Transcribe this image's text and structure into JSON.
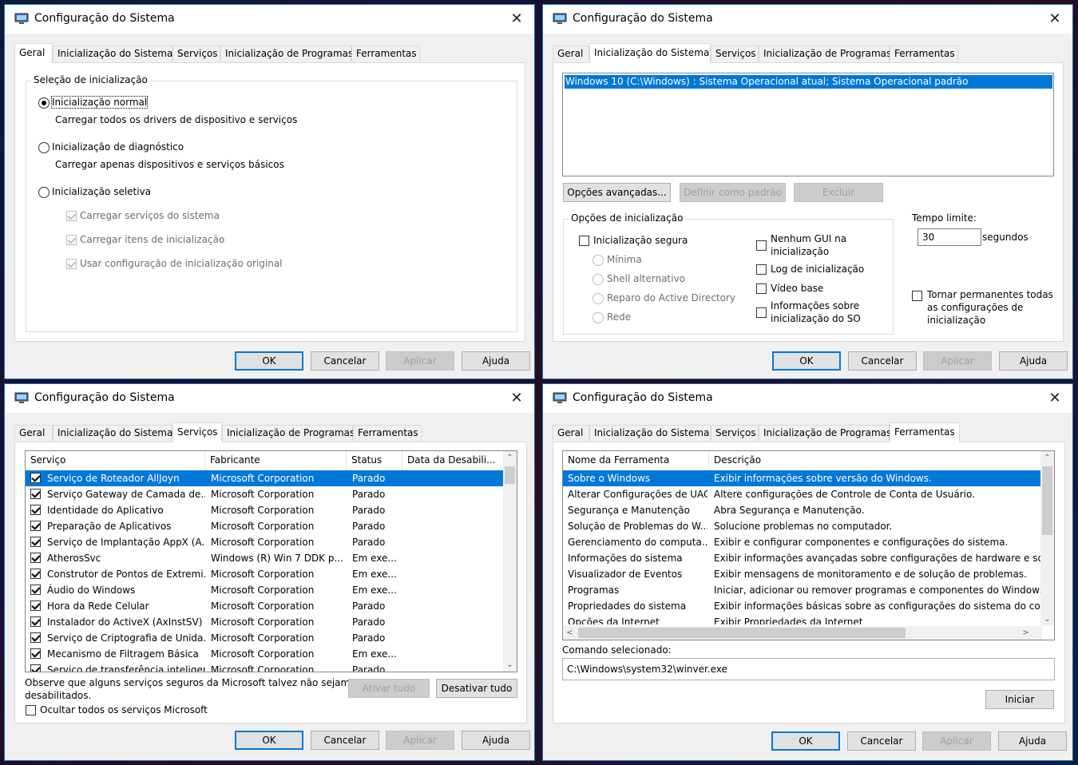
{
  "title": "Configuração do Sistema",
  "tabs": [
    "Geral",
    "Inicialização do Sistema",
    "Serviços",
    "Inicialização de Programas",
    "Ferramentas"
  ],
  "buttons": {
    "ok": "OK",
    "cancel": "Cancelar",
    "apply": "Aplicar",
    "help": "Ajuda"
  },
  "geral": {
    "group_title": "Seleção de inicialização",
    "normal": "Inicialização normal",
    "normal_desc": "Carregar todos os drivers de dispositivo e serviços",
    "diag": "Inicialização de diagnóstico",
    "diag_desc": "Carregar apenas dispositivos e serviços básicos",
    "selective": "Inicialização seletiva",
    "opt1": "Carregar serviços do sistema",
    "opt2": "Carregar itens de inicialização",
    "opt3": "Usar configuração de inicialização original"
  },
  "boot": {
    "os_entry": "Windows 10 (C:\\Windows) : Sistema Operacional atual; Sistema Operacional padrão",
    "advanced": "Opções avançadas...",
    "set_default": "Definir como padrão",
    "delete": "Excluir",
    "options_title": "Opções de inicialização",
    "safe": "Inicialização segura",
    "minimal": "Mínima",
    "shell": "Shell alternativo",
    "ad": "Reparo do Active Directory",
    "net": "Rede",
    "nogui1": "Nenhum GUI na",
    "nogui2": "inicialização",
    "log": "Log de inicialização",
    "video": "Vídeo base",
    "info1": "Informações sobre",
    "info2": "inicialização do SO",
    "timeout_label": "Tempo limite:",
    "timeout_value": "30",
    "seconds": "segundos",
    "perm1": "Tornar permanentes todas",
    "perm2": "as configurações de",
    "perm3": "inicialização"
  },
  "services": {
    "headers": [
      "Serviço",
      "Fabricante",
      "Status",
      "Data da Desabili..."
    ],
    "rows": [
      [
        "Serviço de Roteador AllJoyn",
        "Microsoft Corporation",
        "Parado"
      ],
      [
        "Serviço Gateway de Camada de...",
        "Microsoft Corporation",
        "Parado"
      ],
      [
        "Identidade do Aplicativo",
        "Microsoft Corporation",
        "Parado"
      ],
      [
        "Preparação de Aplicativos",
        "Microsoft Corporation",
        "Parado"
      ],
      [
        "Serviço de Implantação AppX (A...",
        "Microsoft Corporation",
        "Parado"
      ],
      [
        "AtherosSvc",
        "Windows (R) Win 7 DDK p...",
        "Em exe..."
      ],
      [
        "Construtor de Pontos de Extremi...",
        "Microsoft Corporation",
        "Em exe..."
      ],
      [
        "Áudio do Windows",
        "Microsoft Corporation",
        "Em exe..."
      ],
      [
        "Hora da Rede Celular",
        "Microsoft Corporation",
        "Parado"
      ],
      [
        "Instalador do ActiveX (AxInstSV)",
        "Microsoft Corporation",
        "Parado"
      ],
      [
        "Serviço de Criptografia de Unida...",
        "Microsoft Corporation",
        "Parado"
      ],
      [
        "Mecanismo de Filtragem Básica",
        "Microsoft Corporation",
        "Em exe..."
      ],
      [
        "Serviço de transferência inteligente...",
        "Microsoft Corporation",
        "Parado"
      ]
    ],
    "note1": "Observe que alguns serviços seguros da Microsoft talvez não sejam",
    "note2": "desabilitados.",
    "enable_all": "Ativar tudo",
    "disable_all": "Desativar tudo",
    "hide_ms": "Ocultar todos os serviços Microsoft"
  },
  "tools": {
    "headers": [
      "Nome da Ferramenta",
      "Descrição"
    ],
    "rows": [
      [
        "Sobre o Windows",
        "Exibir informações sobre versão do Windows."
      ],
      [
        "Alterar Configurações de UAC",
        "Altere configurações de Controle de Conta de Usuário."
      ],
      [
        "Segurança e Manutenção",
        "Abra Segurança e Manutenção."
      ],
      [
        "Solução de Problemas do W...",
        "Solucione problemas no computador."
      ],
      [
        "Gerenciamento do computa...",
        "Exibir e configurar componentes e configurações do sistema."
      ],
      [
        "Informações do sistema",
        "Exibir informações avançadas sobre configurações de hardware e soft"
      ],
      [
        "Visualizador de Eventos",
        "Exibir mensagens de monitoramento e de solução de problemas."
      ],
      [
        "Programas",
        "Iniciar, adicionar ou remover programas e componentes do Windows."
      ],
      [
        "Propriedades do sistema",
        "Exibir informações básicas sobre as configurações do sistema do comp"
      ],
      [
        "Opções da Internet",
        "Exibir Propriedades da Internet"
      ]
    ],
    "cmd_label": "Comando selecionado:",
    "cmd_value": "C:\\Windows\\system32\\winver.exe",
    "launch": "Iniciar"
  }
}
